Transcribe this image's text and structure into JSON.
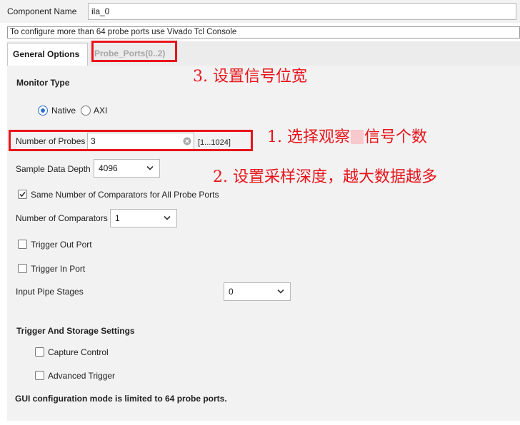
{
  "component": {
    "label": "Component Name",
    "value": "ila_0"
  },
  "info_banner": "To configure more than 64 probe ports use Vivado Tcl Console",
  "tabs": [
    {
      "label": "General Options"
    },
    {
      "label": "Probe_Ports(0..2)"
    }
  ],
  "monitor_type": {
    "heading": "Monitor Type",
    "options": [
      "Native",
      "AXI"
    ],
    "selected": "Native"
  },
  "num_probes": {
    "label": "Number of Probes",
    "value": "3",
    "range": "[1...1024]"
  },
  "sample_depth": {
    "label": "Sample Data Depth",
    "value": "4096"
  },
  "same_comparators": {
    "label": "Same Number of Comparators for All Probe Ports",
    "checked": true
  },
  "num_comparators": {
    "label": "Number of Comparators",
    "value": "1"
  },
  "trigger_out": {
    "label": "Trigger Out Port",
    "checked": false
  },
  "trigger_in": {
    "label": "Trigger In Port",
    "checked": false
  },
  "input_pipe": {
    "label": "Input Pipe Stages",
    "value": "0"
  },
  "trigger_storage": {
    "heading": "Trigger And Storage Settings",
    "capture_control": "Capture Control",
    "advanced_trigger": "Advanced Trigger"
  },
  "footer_note": "GUI configuration mode is limited to 64 probe ports.",
  "annotations": {
    "a1_prefix": "1. 选择观察",
    "a1_suffix": "信号个数",
    "a2": "2. 设置采样深度，越大数据越多",
    "a3": "3. 设置信号位宽"
  },
  "colors": {
    "accent_red": "#e8141b",
    "radio_blue": "#2f6fcf",
    "panel_gray": "#f2f2f2"
  }
}
